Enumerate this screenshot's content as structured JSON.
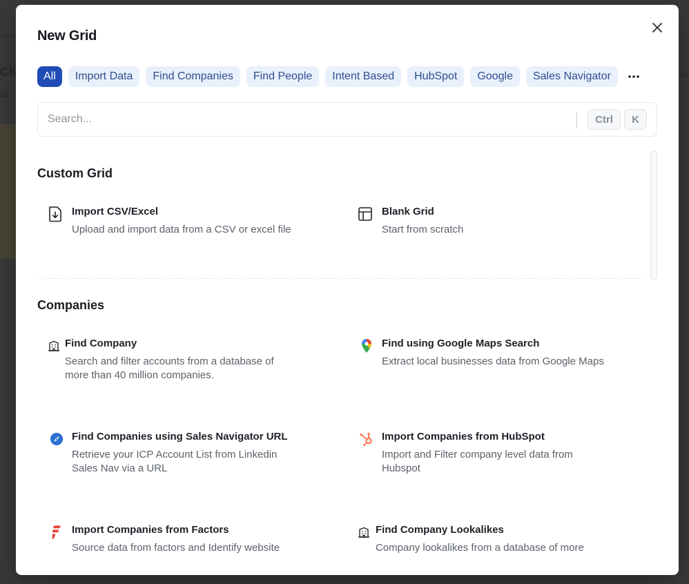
{
  "modal": {
    "title": "New Grid"
  },
  "filters": [
    {
      "label": "All",
      "active": true
    },
    {
      "label": "Import Data"
    },
    {
      "label": "Find Companies"
    },
    {
      "label": "Find People"
    },
    {
      "label": "Intent Based"
    },
    {
      "label": "HubSpot"
    },
    {
      "label": "Google"
    },
    {
      "label": "Sales Navigator"
    }
  ],
  "search": {
    "placeholder": "Search...",
    "shortcut_mod": "Ctrl",
    "shortcut_key": "K"
  },
  "sections": {
    "custom_grid": {
      "title": "Custom Grid",
      "items": [
        {
          "name": "Import CSV/Excel",
          "desc": "Upload and import data from a CSV or excel file",
          "icon": "file-import-icon"
        },
        {
          "name": "Blank Grid",
          "desc": "Start from scratch",
          "icon": "table-layout-icon"
        }
      ]
    },
    "companies": {
      "title": "Companies",
      "items": [
        {
          "name": "Find Company",
          "desc": "Search and filter accounts from a database of more than 40 million companies.",
          "icon": "building-icon"
        },
        {
          "name": "Find using Google Maps Search",
          "desc": "Extract local businesses data from Google Maps",
          "icon": "google-maps-pin-icon"
        },
        {
          "name": "Find Companies using Sales Navigator URL",
          "desc": "Retrieve your ICP Account List from Linkedin Sales Nav via a URL",
          "icon": "compass-icon"
        },
        {
          "name": "Import Companies from HubSpot",
          "desc": "Import and Filter company level data from Hubspot",
          "icon": "hubspot-icon"
        },
        {
          "name": "Import Companies from Factors",
          "desc": "Source data from factors and Identify website",
          "icon": "factors-icon"
        },
        {
          "name": "Find Company Lookalikes",
          "desc": "Company lookalikes from a database of more",
          "icon": "building-icon"
        }
      ]
    }
  },
  "colors": {
    "chip_active_bg": "#1f4bb5",
    "chip_bg": "#e8f0fb",
    "hubspot": "#ff7a59",
    "factors": "#e8413a",
    "sales_nav": "#2c6fd1"
  }
}
